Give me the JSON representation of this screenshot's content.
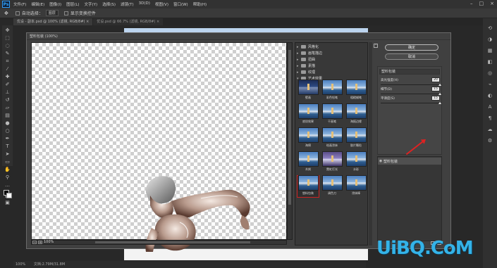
{
  "app": {
    "logo": "Ps"
  },
  "menubar": {
    "items": [
      "文件(F)",
      "编辑(E)",
      "图像(I)",
      "图层(L)",
      "文字(Y)",
      "选择(S)",
      "滤镜(T)",
      "3D(D)",
      "视图(V)",
      "窗口(W)",
      "帮助(H)"
    ],
    "window_controls": [
      "minimize-icon",
      "maximize-icon",
      "close-icon"
    ]
  },
  "options_bar": {
    "auto_select_label": "自动选择：",
    "auto_select_value": "图层",
    "show_transform_label": "显示变换控件"
  },
  "tabs": [
    {
      "label": "优设 - 副本.psd @ 100% (滤镜, RGB/8#) ×"
    },
    {
      "label": "优设.psd @ 66.7% (滤镜, RGB/8#) ×"
    }
  ],
  "status_bar": {
    "zoom": "100%",
    "doc_info": "文档:2.79M/31.8M"
  },
  "dialog": {
    "title": "塑料包装 (100%)",
    "zoom_value": "100%",
    "folders": [
      "风格化",
      "画笔描边",
      "扭曲",
      "素描",
      "纹理",
      "艺术效果"
    ],
    "filters": [
      {
        "label": "壁画",
        "style": "dark"
      },
      {
        "label": "彩色铅笔",
        "style": "normal"
      },
      {
        "label": "粗糙蜡笔",
        "style": "normal"
      },
      {
        "label": "底纹效果",
        "style": "normal"
      },
      {
        "label": "干画笔",
        "style": "normal"
      },
      {
        "label": "海报边缘",
        "style": "normal"
      },
      {
        "label": "海绵",
        "style": "normal"
      },
      {
        "label": "绘画涂抹",
        "style": "normal"
      },
      {
        "label": "胶片颗粒",
        "style": "normal"
      },
      {
        "label": "木刻",
        "style": "normal"
      },
      {
        "label": "霓虹灯光",
        "style": "violet"
      },
      {
        "label": "水彩",
        "style": "normal"
      },
      {
        "label": "塑料包装",
        "style": "normal",
        "selected": true
      },
      {
        "label": "调色刀",
        "style": "normal"
      },
      {
        "label": "涂抹棒",
        "style": "normal"
      }
    ],
    "ok_label": "确定",
    "cancel_label": "取消",
    "filter_select": "塑料包装",
    "params": [
      {
        "label": "高光强度(H)",
        "value": "20",
        "fraction": 1.0
      },
      {
        "label": "细节(D)",
        "value": "15",
        "fraction": 1.0
      },
      {
        "label": "平滑度(S)",
        "value": "15",
        "fraction": 1.0
      }
    ],
    "layer_name": "塑料包装"
  },
  "watermark": "UiBQ.CoM",
  "colors": {
    "accent_red": "#d22222",
    "watermark": "#34b3e8"
  }
}
